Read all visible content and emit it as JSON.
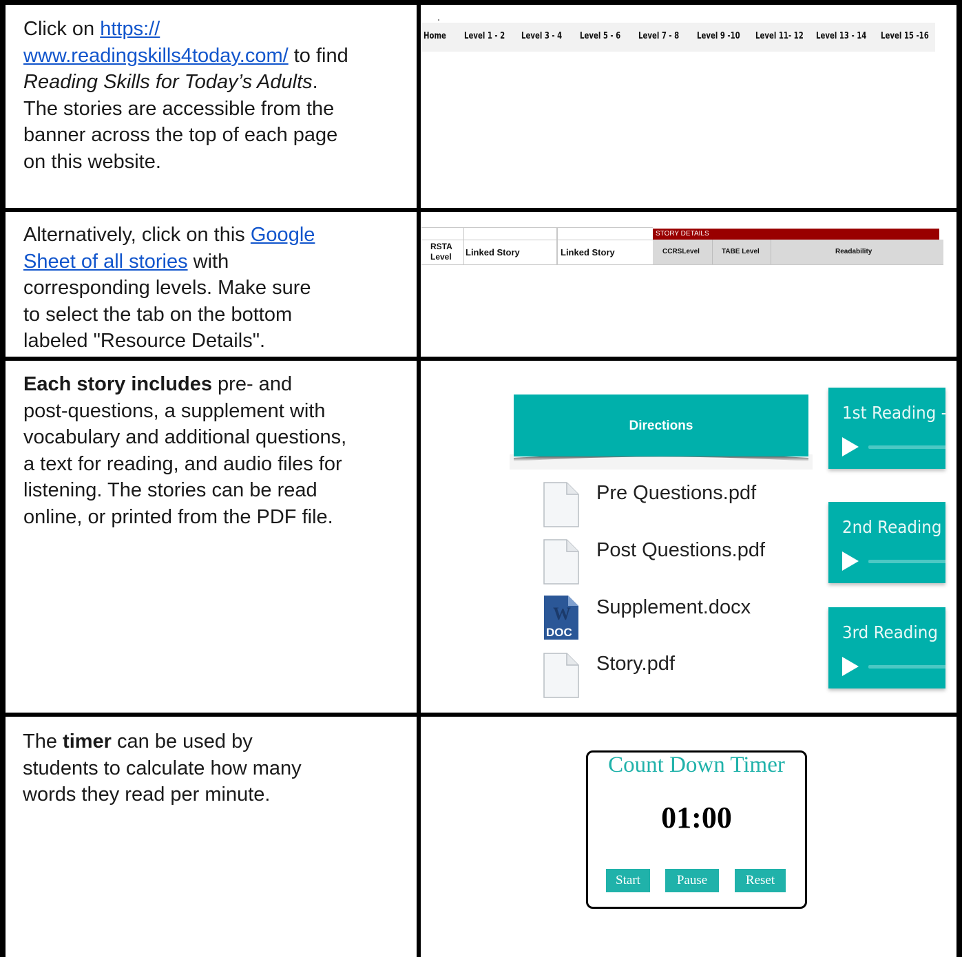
{
  "row1": {
    "text_prefix": "Click on ",
    "link_line1": "https://",
    "link_line2": "www.readingskills4today.com/",
    "text_after_link": " to find",
    "italic_title": "Reading Skills for Today’s Adults",
    "period": ".",
    "line4": "The stories are accessible from the",
    "line5": "banner across the top of each page",
    "line6": "on this website.",
    "nav_items": [
      "Home",
      "Level 1 - 2",
      "Level 3 - 4",
      "Level 5 - 6",
      "Level 7 - 8",
      "Level 9 -10",
      "Level 11- 12",
      "Level 13 - 14",
      "Level 15 -16"
    ]
  },
  "row2": {
    "text_prefix": "Alternatively, click on this ",
    "link_line1": "Google",
    "link_line2": "Sheet of all stories",
    "text_after_link": " with",
    "line3": "corresponding levels. Make sure",
    "line4": "to select the tab on the bottom",
    "line5": "labeled \"Resource Details\".",
    "sheet": {
      "group_label": "STORY DETAILS",
      "rsta_line1": "RSTA",
      "rsta_line2": "Level",
      "linked_story_1": "Linked Story",
      "linked_story_2": "Linked Story",
      "ccrs": "CCRSLevel",
      "tabe": "TABE Level",
      "readability": "Readability",
      "group_color": "#990000"
    }
  },
  "row3": {
    "bold_lead": "Each story includes",
    "line1_rest": " pre- and",
    "line2": "post-questions, a supplement with",
    "line3": "vocabulary and additional questions,",
    "line4": "a text for reading, and audio files for",
    "line5": "listening. The stories can be read",
    "line6": "online, or printed from the PDF file.",
    "directions_label": "Directions",
    "files": [
      "Pre Questions.pdf",
      "Post Questions.pdf",
      "Supplement.docx",
      "Story.pdf"
    ],
    "doc_badge": "DOC",
    "doc_letter": "W",
    "audio": [
      "1st Reading -",
      "2nd Reading",
      "3rd Reading"
    ],
    "accent_color": "#00b0ab"
  },
  "row4": {
    "text_prefix": "The ",
    "bold_word": "timer",
    "line1_rest": " can be used by",
    "line2": "students to calculate how many",
    "line3": "words they read per minute.",
    "timer_title": "Count Down Timer",
    "timer_value": "01:00",
    "buttons": [
      "Start",
      "Pause",
      "Reset"
    ],
    "timer_color": "#20b2aa"
  }
}
